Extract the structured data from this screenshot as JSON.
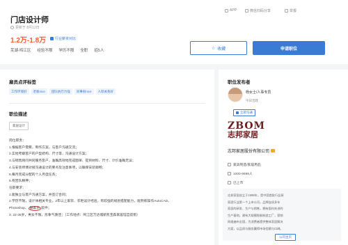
{
  "job": {
    "title": "门店设计师",
    "updated": "更新于 8月12日",
    "salary": "1.2万-1.8万",
    "salary_badge": "行业薪资对比",
    "attributes": [
      "芜湖-鸠江区",
      "经验不限",
      "学历不限",
      "全职",
      "招5人"
    ]
  },
  "header_actions": [
    {
      "label": "APP",
      "icon": "phone-icon"
    },
    {
      "label": "微信扫码分享",
      "icon": "wechat-icon"
    },
    {
      "label": "举报",
      "icon": "report-icon"
    }
  ],
  "buttons": {
    "favorite": "收藏",
    "favorite_icon": "star-icon",
    "apply": "申请职位"
  },
  "review": {
    "title": "雇员点评标签",
    "tags": [
      "工作环境好",
      "老板nice",
      "团队执行力强",
      "同事很nice",
      "人际关系好"
    ]
  },
  "description": {
    "title": "职位描述",
    "chip": "家居设计",
    "lines": [
      "岗位职责：",
      "1.根据客户需要，制作方案，与客户沟通交流；",
      "2.实地考察客户的户型结构、尺寸等，沟通设计方案；",
      "3.与销售顾问共同服务客户，准确高效地完成图单、提到材料、尺寸、计价准确无误；",
      "4.与安装师傅对接沟通设计的要点及注意事项，以确保安装顺畅；",
      "5.每月完成分配的个人月度任务；",
      "6.有团队精神；",
      "任职要求：",
      "1.能独立与客户沟通方案，并签订合同；",
      "2.学历不限，设计体相关专业，2年以上家装、衣柜设计经验，有较强的规划搭配能力，能熟练操作AutoCAD、"
    ],
    "line11_before": "Photoshop、",
    "line11_circled": "酷家乐",
    "line11_after": "软件；",
    "line12": "3. 22-35岁，男女不限，形象气质佳；（工作地点：鸠江区万达城新凯宝森家居馆自前街）"
  },
  "publisher": {
    "title": "职位发布者",
    "name": "杨女士/人事专员",
    "active": "今日活跃",
    "chat": "立即沟通"
  },
  "company": {
    "logo_top": "ZBOM",
    "logo_bottom": "志邦家居",
    "name": "志邦家居股份有限公司",
    "industry": "家具制造/家居用品",
    "size": "1000-9999人",
    "stage": "已上市",
    "intro": [
      "志邦家居创立于1998年，是中国首批行业厨",
      "家居行业第一个上市公司，品牌连续多年",
      "家居的研发、生产与销售，拥有国内先进的",
      "生产基地，建有大规模智能制造工厂，营销",
      "网络遍布全国，为消费者提供整体家居解决",
      "方案，以品质与服务赢得市场信赖与口碑。"
    ],
    "more": "公司主页"
  }
}
